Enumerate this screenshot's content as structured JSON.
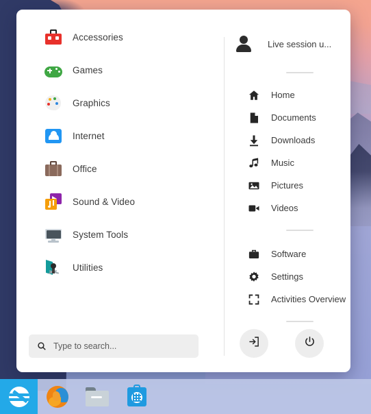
{
  "desktop": {
    "wallpaper_name": "misty-mountains-wallpaper",
    "accent_color": "#23a9e8",
    "panel_color": "#bdc7e6"
  },
  "menu": {
    "categories": [
      {
        "label": "Accessories",
        "icon": "toolbox-icon"
      },
      {
        "label": "Games",
        "icon": "gamepad-icon"
      },
      {
        "label": "Graphics",
        "icon": "palette-icon"
      },
      {
        "label": "Internet",
        "icon": "cloud-icon"
      },
      {
        "label": "Office",
        "icon": "briefcase-icon"
      },
      {
        "label": "Sound & Video",
        "icon": "music-video-icon"
      },
      {
        "label": "System Tools",
        "icon": "monitor-icon"
      },
      {
        "label": "Utilities",
        "icon": "tools-icon"
      }
    ],
    "user": {
      "name": "Live session u...",
      "icon": "user-avatar-icon"
    },
    "places": [
      {
        "label": "Home",
        "icon": "home-icon"
      },
      {
        "label": "Documents",
        "icon": "document-icon"
      },
      {
        "label": "Downloads",
        "icon": "download-icon"
      },
      {
        "label": "Music",
        "icon": "music-note-icon"
      },
      {
        "label": "Pictures",
        "icon": "image-icon"
      },
      {
        "label": "Videos",
        "icon": "video-camera-icon"
      }
    ],
    "system": [
      {
        "label": "Software",
        "icon": "briefcase-solid-icon"
      },
      {
        "label": "Settings",
        "icon": "gear-icon"
      },
      {
        "label": "Activities Overview",
        "icon": "expand-frame-icon"
      }
    ],
    "search": {
      "placeholder": "Type to search...",
      "value": "",
      "icon": "search-icon"
    },
    "actions": [
      {
        "name": "logout-button",
        "icon": "logout-icon"
      },
      {
        "name": "power-button",
        "icon": "power-icon"
      }
    ]
  },
  "taskbar": {
    "start": {
      "label": "Zorin Menu",
      "icon": "zorin-logo-icon"
    },
    "items": [
      {
        "label": "Firefox Web Browser",
        "icon": "firefox-icon"
      },
      {
        "label": "Files",
        "icon": "file-manager-icon"
      },
      {
        "label": "Software",
        "icon": "software-store-icon"
      }
    ]
  }
}
